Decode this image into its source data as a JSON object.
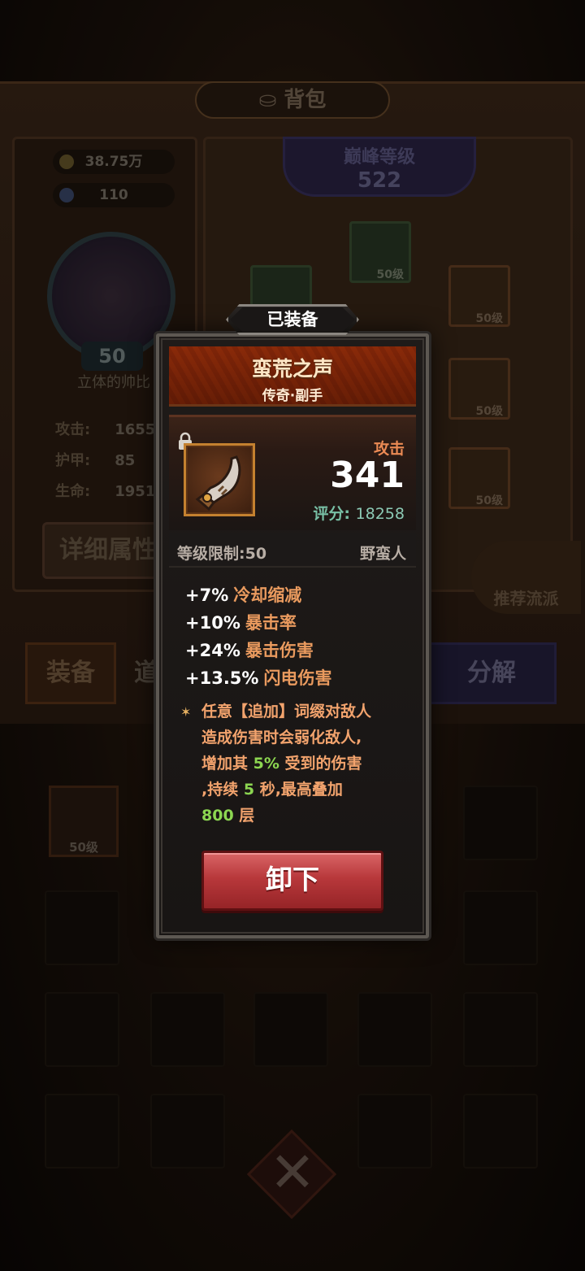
{
  "background": {
    "window_title": "背包",
    "gold": "38.75万",
    "gems": "110",
    "avatar_level": "50",
    "player_name": "立体的帅比",
    "stats": [
      {
        "label": "攻击:",
        "value": "1655"
      },
      {
        "label": "护甲:",
        "value": "85"
      },
      {
        "label": "生命:",
        "value": "1951"
      }
    ],
    "detail_button": "详细属性",
    "peak_level_label": "巅峰等级",
    "peak_level_value": "522",
    "slot_level": "50级",
    "recommend_button": "推荐流派",
    "tabs": {
      "equip": "装备",
      "items": "道",
      "salvage": "分解"
    },
    "inventory_item_level": "50级"
  },
  "popup": {
    "equipped_tag": "已装备",
    "item_name": "蛮荒之声",
    "item_subtitle": "传奇·副手",
    "stat_label": "攻击",
    "stat_value": "341",
    "score_label": "评分:",
    "score_value": "18258",
    "level_req": "等级限制:50",
    "class_name": "野蛮人",
    "affixes": [
      {
        "value": "+7%",
        "name": "冷却缩减"
      },
      {
        "value": "+10%",
        "name": "暴击率"
      },
      {
        "value": "+24%",
        "name": "暴击伤害"
      },
      {
        "value": "+13.5%",
        "name": "闪电伤害"
      }
    ],
    "legendary": {
      "l1": "任意【追加】词缀对敌人",
      "l2": "造成伤害时会弱化敌人,",
      "l3a": "增加其",
      "l3b": "5%",
      "l3c": "受到的伤害",
      "l4a": ",持续",
      "l4b": "5",
      "l4c": "秒,最高叠加",
      "l5a": "800",
      "l5b": "层"
    },
    "unequip_button": "卸下"
  },
  "colors": {
    "banner": "#b7652e",
    "stat_label": "#ea8a54",
    "score": "#78c0a6",
    "affix_name": "#e99a5e",
    "legend_highlight": "#8cd651",
    "button": "#b8383b"
  }
}
